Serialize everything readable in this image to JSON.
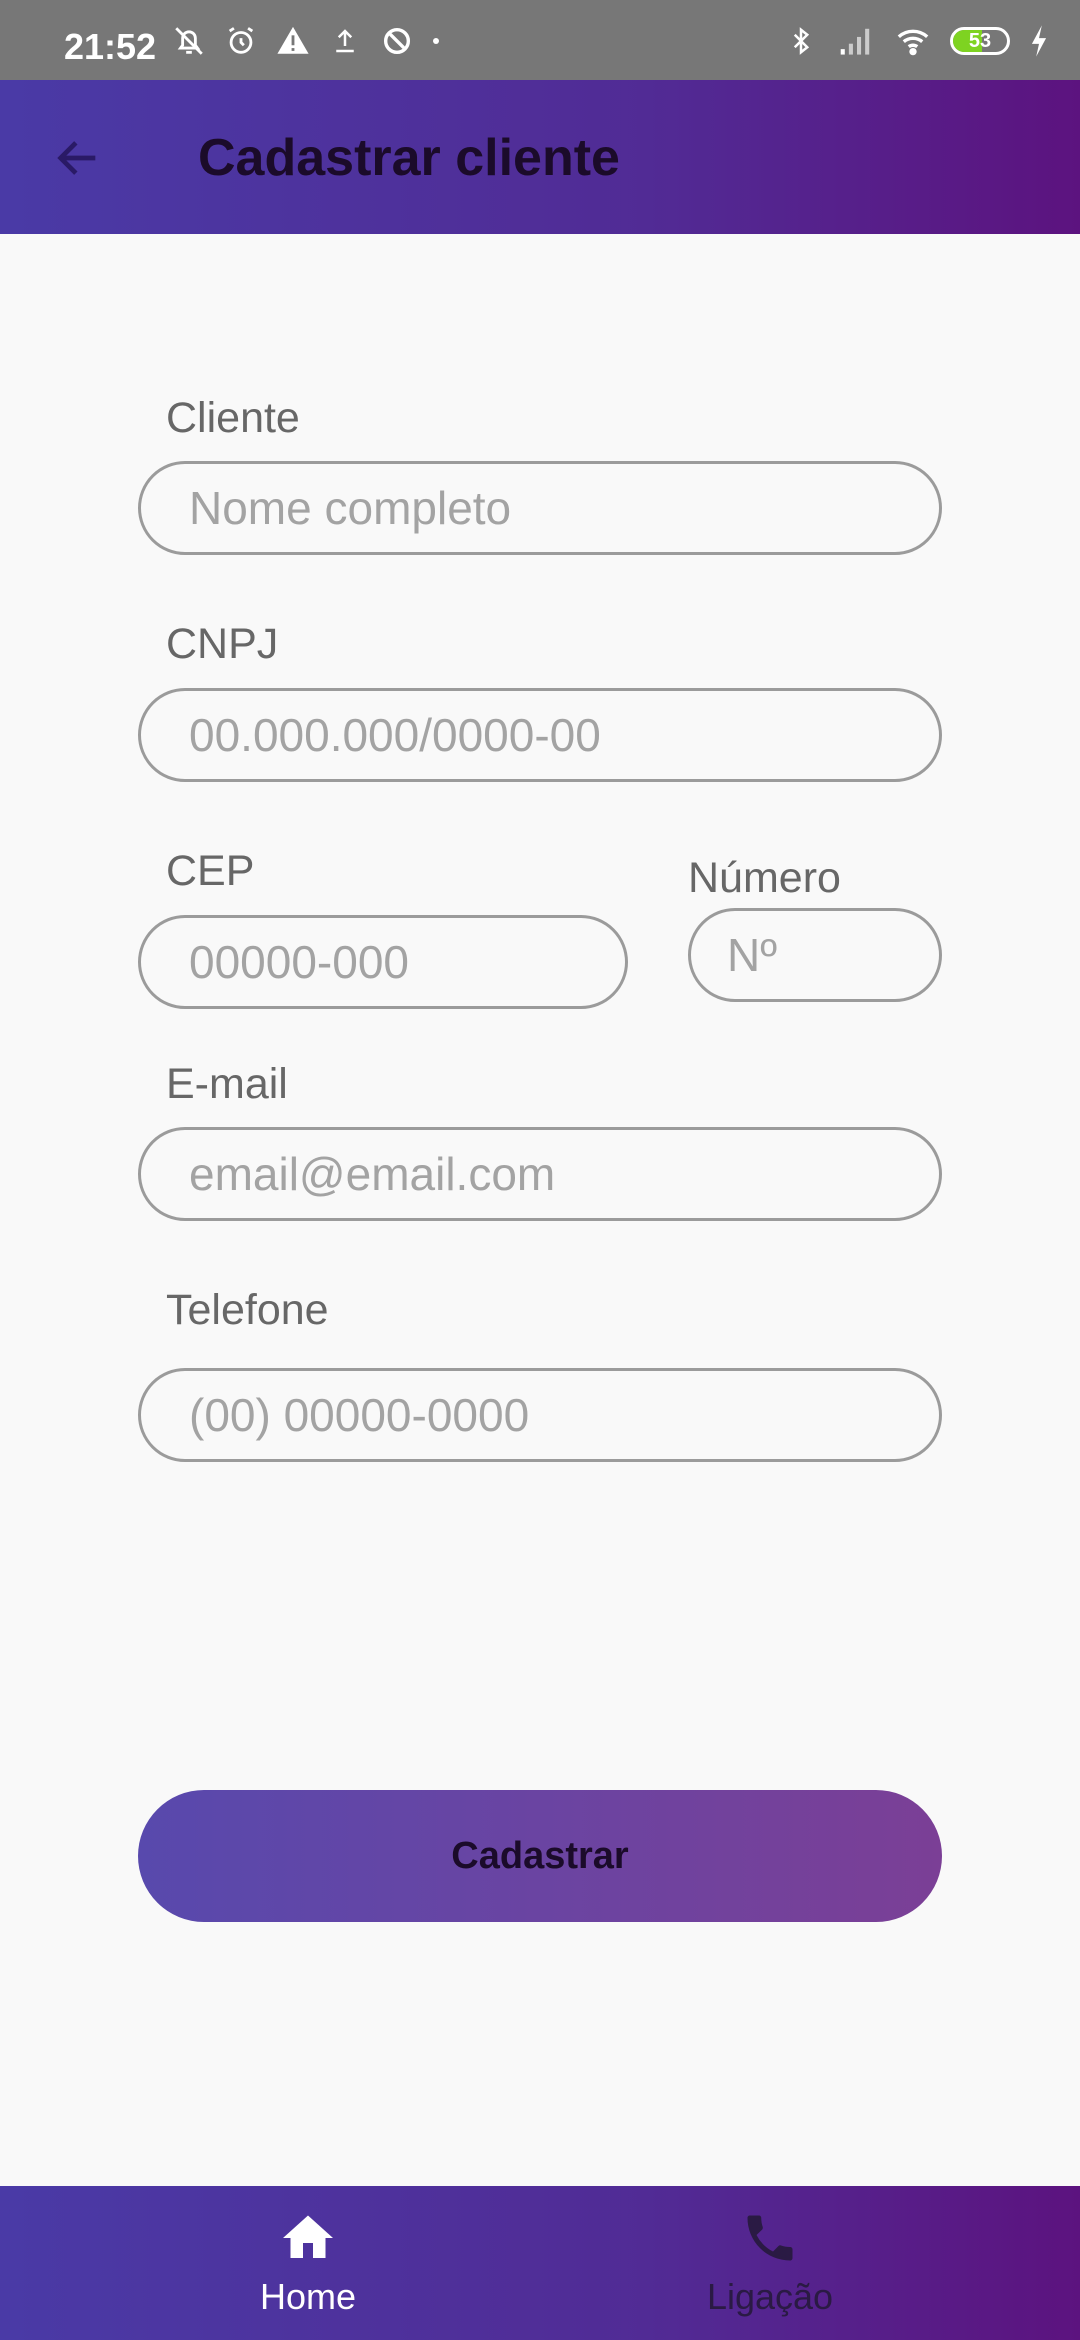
{
  "status_bar": {
    "time": "21:52",
    "battery": "53",
    "battery_level": 0.53,
    "icons_left": [
      "bell-off-icon",
      "alarm-icon",
      "warning-icon",
      "upload-icon",
      "data-saver-icon",
      "dot-icon"
    ],
    "icons_right": [
      "bluetooth-icon",
      "signal-icon",
      "wifi-icon",
      "battery-icon",
      "charging-icon"
    ]
  },
  "app_bar": {
    "title": "Cadastrar cliente",
    "back_icon": "arrow-back-icon"
  },
  "form": {
    "cliente": {
      "label": "Cliente",
      "placeholder": "Nome completo",
      "value": ""
    },
    "cnpj": {
      "label": "CNPJ",
      "placeholder": "00.000.000/0000-00",
      "value": ""
    },
    "cep": {
      "label": "CEP",
      "placeholder": "00000-000",
      "value": ""
    },
    "numero": {
      "label": "Número",
      "placeholder": "Nº",
      "value": ""
    },
    "email": {
      "label": "E-mail",
      "placeholder": "email@email.com",
      "value": ""
    },
    "telefone": {
      "label": "Telefone",
      "placeholder": "(00) 00000-0000",
      "value": ""
    },
    "submit_label": "Cadastrar"
  },
  "bottom_nav": {
    "items": [
      {
        "label": "Home",
        "icon": "home-icon",
        "active": true
      },
      {
        "label": "Ligação",
        "icon": "phone-icon",
        "active": false
      }
    ]
  },
  "colors": {
    "brand_start": "#4a3aa6",
    "brand_end": "#5c137f",
    "button_start": "#5849ad",
    "button_end": "#7b3f96",
    "status_bar": "#777777"
  }
}
